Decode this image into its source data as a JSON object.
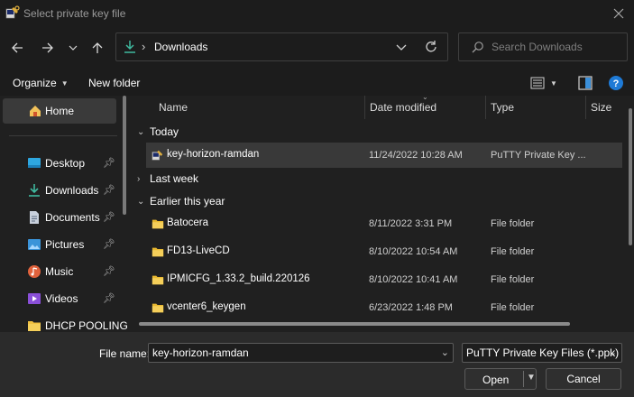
{
  "window": {
    "title": "Select private key file",
    "close_icon": "close-icon"
  },
  "navigation": {
    "back_icon": "arrow-left-icon",
    "forward_icon": "arrow-right-icon",
    "recent_icon": "chevron-down-icon",
    "up_icon": "arrow-up-icon",
    "address": {
      "icon": "download-icon",
      "separator": "›",
      "path": "Downloads",
      "dropdown_icon": "chevron-down-icon",
      "refresh_icon": "refresh-icon"
    },
    "search": {
      "placeholder": "Search Downloads",
      "icon": "search-icon"
    }
  },
  "toolbar": {
    "organize_label": "Organize",
    "new_folder_label": "New folder",
    "view_icon": "list-view-icon",
    "preview_icon": "preview-pane-icon",
    "help_icon": "help-icon"
  },
  "sidebar": {
    "home": {
      "label": "Home",
      "icon": "home-icon"
    },
    "items": [
      {
        "label": "Desktop",
        "icon": "desktop-icon",
        "pinned": true
      },
      {
        "label": "Downloads",
        "icon": "download-icon",
        "pinned": true
      },
      {
        "label": "Documents",
        "icon": "document-icon",
        "pinned": true
      },
      {
        "label": "Pictures",
        "icon": "pictures-icon",
        "pinned": true
      },
      {
        "label": "Music",
        "icon": "music-icon",
        "pinned": true
      },
      {
        "label": "Videos",
        "icon": "videos-icon",
        "pinned": true
      },
      {
        "label": "DHCP POOLING",
        "icon": "folder-icon",
        "pinned": false
      }
    ]
  },
  "file_list": {
    "columns": [
      "Name",
      "Date modified",
      "Type",
      "Size"
    ],
    "groups": [
      {
        "label": "Today",
        "expanded": true
      },
      {
        "label": "Last week",
        "expanded": false
      },
      {
        "label": "Earlier this year",
        "expanded": true
      }
    ],
    "rows": [
      {
        "name": "key-horizon-ramdan",
        "date": "11/24/2022 10:28 AM",
        "type": "PuTTY Private Key ...",
        "icon": "putty-key-icon",
        "selected": true
      },
      {
        "name": "Batocera",
        "date": "8/11/2022 3:31 PM",
        "type": "File folder",
        "icon": "folder-icon",
        "selected": false
      },
      {
        "name": "FD13-LiveCD",
        "date": "8/10/2022 10:54 AM",
        "type": "File folder",
        "icon": "folder-icon",
        "selected": false
      },
      {
        "name": "IPMICFG_1.33.2_build.220126",
        "date": "8/10/2022 10:41 AM",
        "type": "File folder",
        "icon": "folder-icon",
        "selected": false
      },
      {
        "name": "vcenter6_keygen",
        "date": "6/23/2022 1:48 PM",
        "type": "File folder",
        "icon": "folder-icon",
        "selected": false
      }
    ]
  },
  "footer": {
    "file_name_label": "File name:",
    "file_name_value": "key-horizon-ramdan",
    "file_type_value": "PuTTY Private Key Files (*.ppk)",
    "open_label": "Open",
    "cancel_label": "Cancel"
  },
  "colors": {
    "background": "#202020",
    "chrome": "#1c1c1c",
    "footer": "#2b2b2b",
    "selection": "#393939",
    "accent": "#0078d4",
    "folder": "#f0c040"
  }
}
